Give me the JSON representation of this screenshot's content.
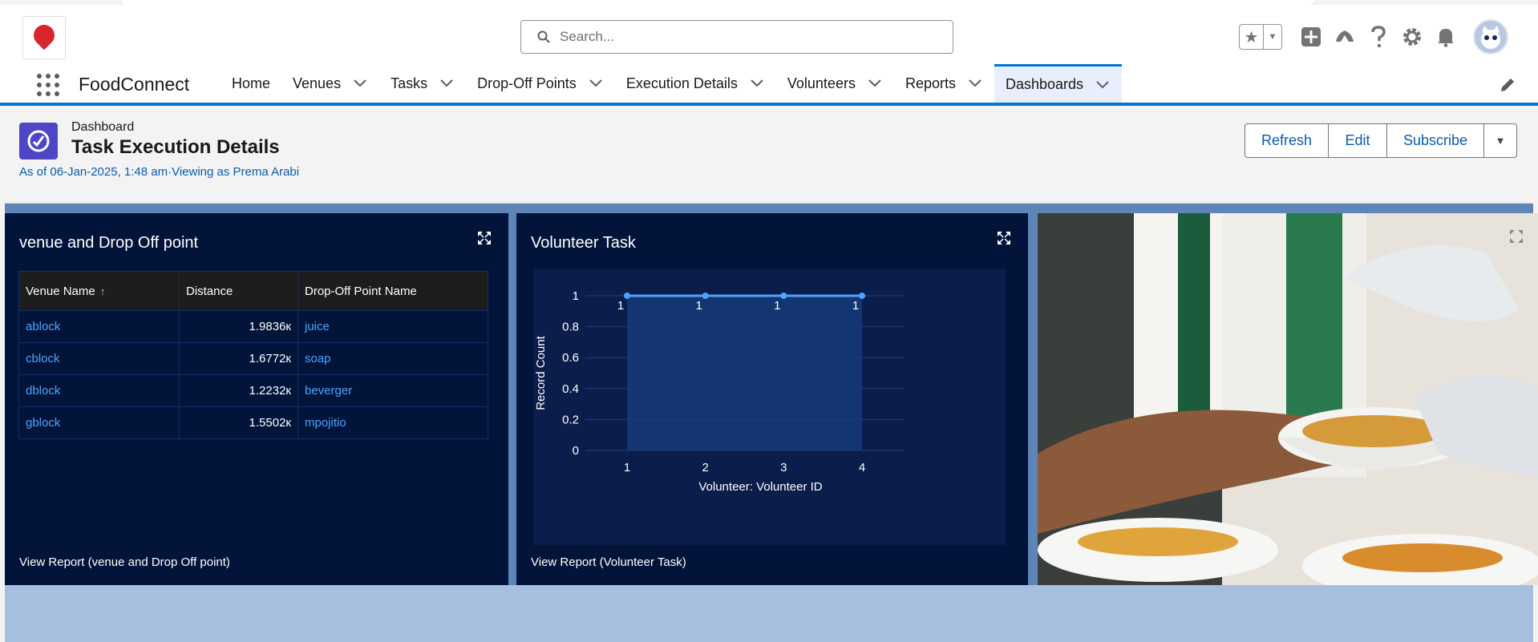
{
  "header": {
    "search_placeholder": "Search...",
    "icons": [
      "star-icon",
      "add-icon",
      "trailhead-icon",
      "help-icon",
      "gear-icon",
      "bell-icon",
      "avatar"
    ]
  },
  "nav": {
    "app_name": "FoodConnect",
    "items": [
      {
        "label": "Home"
      },
      {
        "label": "Venues"
      },
      {
        "label": "Tasks"
      },
      {
        "label": "Drop-Off Points"
      },
      {
        "label": "Execution Details"
      },
      {
        "label": "Volunteers"
      },
      {
        "label": "Reports"
      },
      {
        "label": "Dashboards"
      }
    ]
  },
  "page": {
    "object_type": "Dashboard",
    "title": "Task Execution Details",
    "meta": "As of 06-Jan-2025, 1:48 am·Viewing as Prema Arabi",
    "buttons": {
      "refresh": "Refresh",
      "edit": "Edit",
      "subscribe": "Subscribe"
    }
  },
  "table_card": {
    "title": "venue and Drop Off point",
    "columns": [
      "Venue Name",
      "Distance",
      "Drop-Off Point Name"
    ],
    "rows": [
      [
        "ablock",
        "1.9836к",
        "juice"
      ],
      [
        "cblock",
        "1.6772к",
        "soap"
      ],
      [
        "dblock",
        "1.2232к",
        "beverger"
      ],
      [
        "gblock",
        "1.5502к",
        "mpojitio"
      ]
    ],
    "footer": "View Report (venue and Drop Off point)"
  },
  "chart_card": {
    "title": "Volunteer Task",
    "footer": "View Report (Volunteer Task)"
  },
  "chart_data": {
    "type": "area",
    "x": [
      "1",
      "2",
      "3",
      "4"
    ],
    "values": [
      1,
      1,
      1,
      1
    ],
    "xlabel": "Volunteer: Volunteer ID",
    "ylabel": "Record Count",
    "yticks": [
      "0",
      "0.2",
      "0.4",
      "0.6",
      "0.8",
      "1"
    ],
    "ylim": [
      0,
      1
    ],
    "data_labels": [
      "1",
      "1",
      "1",
      "1"
    ],
    "colors": {
      "line": "#4da3ff",
      "fill": "#153a78",
      "bg": "#0b1d4a"
    }
  }
}
